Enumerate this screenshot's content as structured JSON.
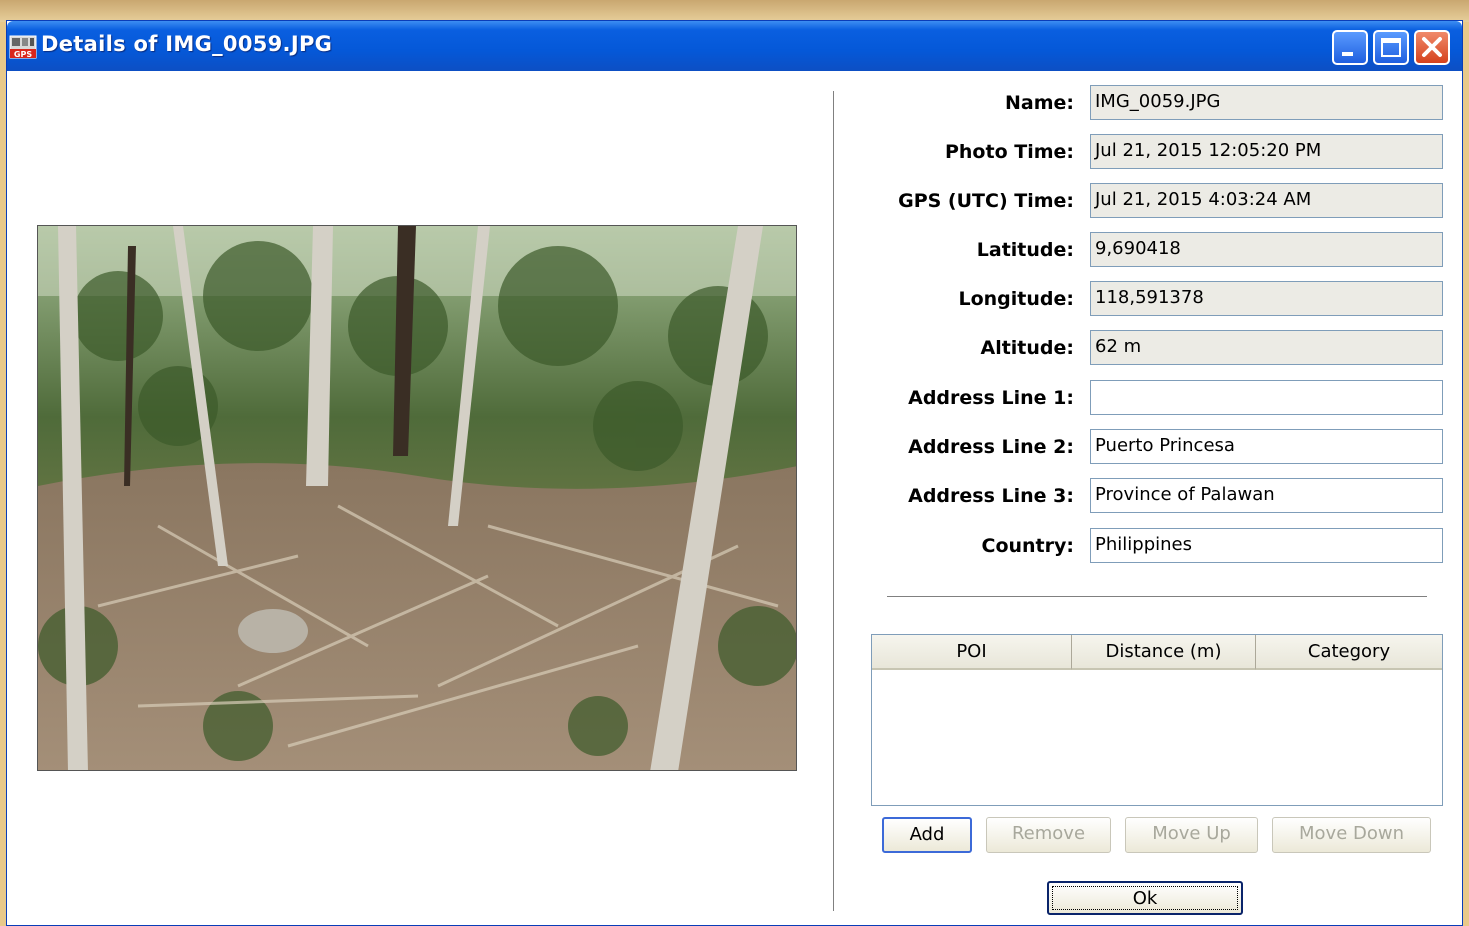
{
  "window": {
    "title": "Details of IMG_0059.JPG"
  },
  "fields": [
    {
      "label": "Name:",
      "value": "IMG_0059.JPG"
    },
    {
      "label": "Photo Time:",
      "value": "Jul 21, 2015 12:05:20 PM"
    },
    {
      "label": "GPS (UTC) Time:",
      "value": "Jul 21, 2015 4:03:24 AM"
    },
    {
      "label": "Latitude:",
      "value": "9,690418"
    },
    {
      "label": "Longitude:",
      "value": "118,591378"
    },
    {
      "label": "Altitude:",
      "value": "62 m"
    },
    {
      "label": "Address Line 1:",
      "value": ""
    },
    {
      "label": "Address Line 2:",
      "value": "Puerto Princesa"
    },
    {
      "label": "Address Line 3:",
      "value": "Province of Palawan"
    },
    {
      "label": "Country:",
      "value": "Philippines"
    }
  ],
  "poi_table": {
    "columns": [
      "POI",
      "Distance (m)",
      "Category"
    ],
    "rows": []
  },
  "buttons": {
    "add": "Add",
    "remove": "Remove",
    "move_up": "Move Up",
    "move_down": "Move Down",
    "ok": "Ok"
  },
  "colors": {
    "titlebar": "#0558d8",
    "readonly_field": "#ecebe5",
    "field_border": "#7f9db9"
  }
}
